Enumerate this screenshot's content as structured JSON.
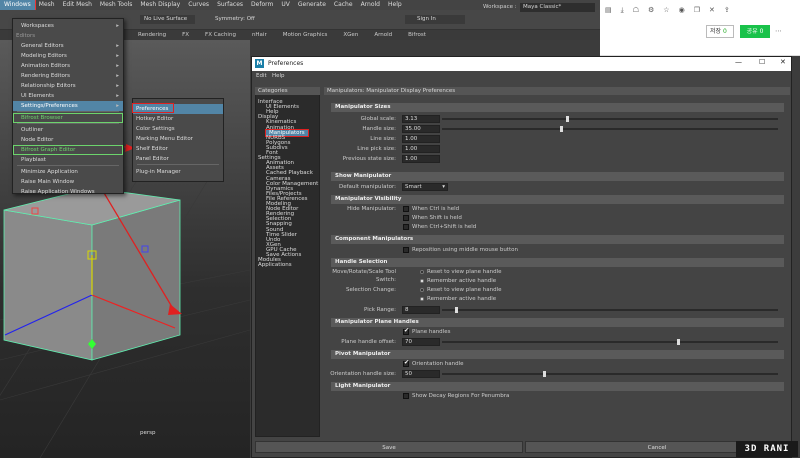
{
  "maya": {
    "menubar": [
      "Windows",
      "Mesh",
      "Edit Mesh",
      "Mesh Tools",
      "Mesh Display",
      "Curves",
      "Surfaces",
      "Deform",
      "UV",
      "Generate",
      "Cache",
      "Arnold",
      "Help"
    ],
    "workspace_label": "Workspace :",
    "workspace_value": "Maya Classic*",
    "sign_in": "Sign In",
    "no_live_surface": "No Live Surface",
    "symmetry": "Symmetry: Off",
    "shelf_tabs": [
      "Rendering",
      "FX",
      "FX Caching",
      "nHair",
      "Motion Graphics",
      "XGen",
      "Arnold",
      "Bifrost"
    ],
    "viewport_label": "persp"
  },
  "browser": {
    "save_button": "저장",
    "count": "0",
    "share_button": "공유",
    "share_count": "0"
  },
  "windows_menu": {
    "items": [
      {
        "label": "Workspaces",
        "arrow": true
      },
      {
        "label": "Editors",
        "header": true
      },
      {
        "label": "General Editors",
        "arrow": true
      },
      {
        "label": "Modeling Editors",
        "arrow": true
      },
      {
        "label": "Animation Editors",
        "arrow": true
      },
      {
        "label": "Rendering Editors",
        "arrow": true
      },
      {
        "label": "Relationship Editors",
        "arrow": true
      },
      {
        "label": "UI Elements",
        "arrow": true
      },
      {
        "label": "Settings/Preferences",
        "arrow": true,
        "highlight": true
      },
      {
        "label": "Bifrost Browser",
        "green": true
      },
      {
        "label": "Outliner"
      },
      {
        "label": "Node Editor"
      },
      {
        "label": "Bifrost Graph Editor",
        "green": true
      },
      {
        "label": "Playblast"
      },
      {
        "label": "Minimize Application"
      },
      {
        "label": "Raise Main Window"
      },
      {
        "label": "Raise Application Windows"
      }
    ]
  },
  "settings_submenu": {
    "items": [
      "Preferences",
      "Hotkey Editor",
      "Color Settings",
      "Marking Menu Editor",
      "Shelf Editor",
      "Panel Editor",
      "Plug-in Manager"
    ]
  },
  "prefs": {
    "title": "Preferences",
    "menu": [
      "Edit",
      "Help"
    ],
    "categories_header": "Categories",
    "panel_title": "Manipulators: Manipulator Display Preferences",
    "categories": [
      {
        "label": "Interface",
        "indent": 0
      },
      {
        "label": "UI Elements",
        "indent": 1
      },
      {
        "label": "Help",
        "indent": 1
      },
      {
        "label": "Display",
        "indent": 0
      },
      {
        "label": "Kinematics",
        "indent": 1
      },
      {
        "label": "Animation",
        "indent": 1
      },
      {
        "label": "Manipulators",
        "indent": 1,
        "selected": true
      },
      {
        "label": "NURBS",
        "indent": 1
      },
      {
        "label": "Polygons",
        "indent": 1
      },
      {
        "label": "Subdivs",
        "indent": 1
      },
      {
        "label": "Font",
        "indent": 1
      },
      {
        "label": "Settings",
        "indent": 0
      },
      {
        "label": "Animation",
        "indent": 1
      },
      {
        "label": "Assets",
        "indent": 1
      },
      {
        "label": "Cached Playback",
        "indent": 1
      },
      {
        "label": "Cameras",
        "indent": 1
      },
      {
        "label": "Color Management",
        "indent": 1
      },
      {
        "label": "Dynamics",
        "indent": 1
      },
      {
        "label": "Files/Projects",
        "indent": 1
      },
      {
        "label": "File References",
        "indent": 1
      },
      {
        "label": "Modeling",
        "indent": 1
      },
      {
        "label": "Node Editor",
        "indent": 1
      },
      {
        "label": "Rendering",
        "indent": 1
      },
      {
        "label": "Selection",
        "indent": 1
      },
      {
        "label": "Snapping",
        "indent": 1
      },
      {
        "label": "Sound",
        "indent": 1
      },
      {
        "label": "Time Slider",
        "indent": 1
      },
      {
        "label": "Undo",
        "indent": 1
      },
      {
        "label": "XGen",
        "indent": 1
      },
      {
        "label": "GPU Cache",
        "indent": 1
      },
      {
        "label": "Save Actions",
        "indent": 1
      },
      {
        "label": "Modules",
        "indent": 0
      },
      {
        "label": "Applications",
        "indent": 0
      }
    ],
    "sizes": {
      "header": "Manipulator Sizes",
      "global_scale_label": "Global scale:",
      "global_scale": "3.13",
      "global_scale_frac": 0.37,
      "handle_size_label": "Handle size:",
      "handle_size": "35.00",
      "handle_size_frac": 0.35,
      "line_size_label": "Line size:",
      "line_size": "1.00",
      "line_pick_label": "Line pick size:",
      "line_pick": "1.00",
      "prev_state_label": "Previous state size:",
      "prev_state": "1.00"
    },
    "show": {
      "header": "Show Manipulator",
      "default_label": "Default manipulator:",
      "default_value": "Smart"
    },
    "visibility": {
      "header": "Manipulator Visibility",
      "hide_label": "Hide Manipulator:",
      "options": [
        "When Ctrl is held",
        "When Shift is held",
        "When Ctrl+Shift is held"
      ]
    },
    "component": {
      "header": "Component Manipulators",
      "option": "Reposition using middle mouse button"
    },
    "handle_selection": {
      "header": "Handle Selection",
      "mrs_label": "Move/Rotate/Scale Tool Switch:",
      "mrs_options": [
        "Reset to view plane handle",
        "Remember active handle"
      ],
      "sel_change_label": "Selection Change:",
      "sel_change_options": [
        "Reset to view plane handle",
        "Remember active handle"
      ],
      "pick_range_label": "Pick Range:",
      "pick_range": "8",
      "pick_range_frac": 0.04
    },
    "plane_handles": {
      "header": "Manipulator Plane Handles",
      "option": "Plane handles",
      "offset_label": "Plane handle offset:",
      "offset": "70",
      "offset_frac": 0.7
    },
    "pivot": {
      "header": "Pivot Manipulator",
      "option": "Orientation handle",
      "size_label": "Orientation handle size:",
      "size": "50",
      "size_frac": 0.3
    },
    "light": {
      "header": "Light Manipulator",
      "option": "Show Decay Regions For Penumbra"
    },
    "save_button": "Save",
    "cancel_button": "Cancel"
  },
  "watermark": "3D RANI"
}
